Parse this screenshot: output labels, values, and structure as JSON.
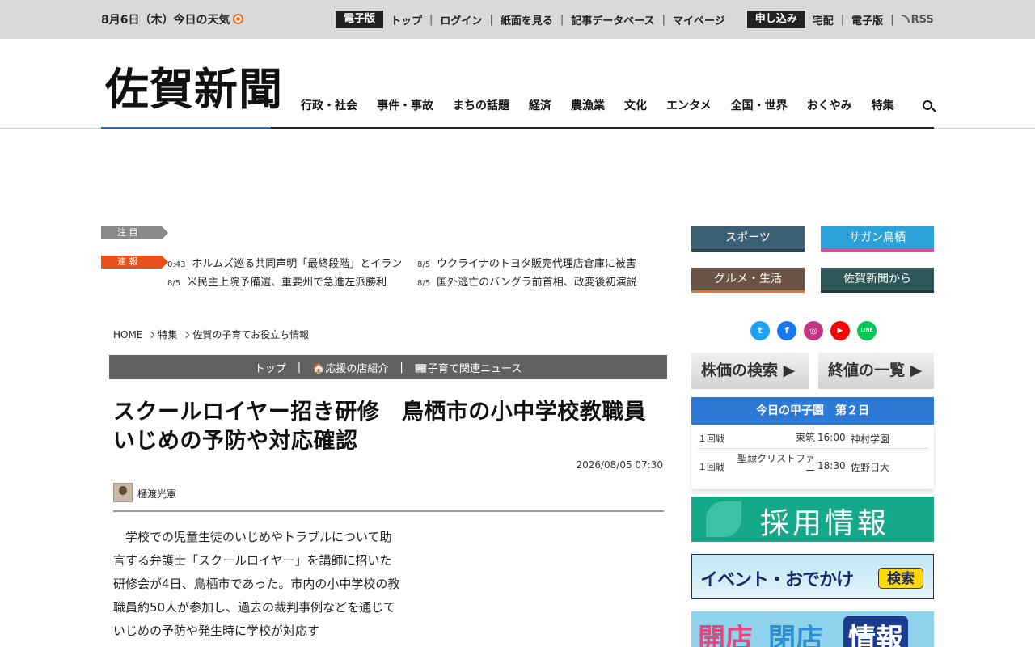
{
  "topbar": {
    "date": "8月6日（木）",
    "weather_label": "今日の天気",
    "nav": [
      "電子版",
      "トップ",
      "ログイン",
      "紙面を見る",
      "記事データベース",
      "マイページ"
    ],
    "nav2": [
      "申し込み",
      "宅配",
      "電子版",
      "RSS"
    ],
    "separator": "|"
  },
  "header": {
    "logo": "佐賀新聞",
    "nav": [
      "行政・社会",
      "事件・事故",
      "まちの話題",
      "経済",
      "農漁業",
      "文化",
      "エンタメ",
      "全国・世界",
      "おくやみ",
      "特集"
    ]
  },
  "ticker": {
    "attention_label": "注 目",
    "breaking_label": "速 報",
    "items": [
      {
        "time": "0:43",
        "text": "ホルムズ巡る共同声明「最終段階」とイラン"
      },
      {
        "time": "8/5",
        "text": "ウクライナのトヨタ販売代理店倉庫に被害"
      },
      {
        "time": "8/5",
        "text": "米民主上院予備選、重要州で急進左派勝利"
      },
      {
        "time": "8/5",
        "text": "国外逃亡のバングラ前首相、政変後初演説"
      }
    ]
  },
  "breadcrumb": [
    "HOME",
    "特集",
    "佐賀の子育てお役立ち情報"
  ],
  "subnav": {
    "items": [
      "トップ",
      "🏠応援の店紹介",
      "📰子育て関連ニュース"
    ],
    "separator": "|"
  },
  "article": {
    "headline_line1": "スクールロイヤー招き研修　鳥栖市の小中学校教職員",
    "headline_line2": "いじめの予防や対応確認",
    "date": "2026/08/05 07:30",
    "author": "樋渡光憲",
    "body": "　学校での児童生徒のいじめやトラブルについて助言する弁護士「スクールロイヤー」を講師に招いた研修会が4日、鳥栖市であった。市内の小中学校の教職員約50人が参加し、過去の裁判事例などを通じていじめの予防や発生時に学校が対応す"
  },
  "sidebar": {
    "categories": [
      {
        "label": "スポーツ",
        "bg": "#3b5f73",
        "bar": "#2a4556"
      },
      {
        "label": "サガン鳥栖",
        "bg": "#2aa1d9",
        "bar": "#e4478e"
      },
      {
        "label": "グルメ・生活",
        "bg": "#6b5446",
        "bar": "#e8762d"
      },
      {
        "label": "佐賀新聞から",
        "bg": "#2f5658",
        "bar": "#1f3b3d"
      }
    ],
    "social": [
      {
        "name": "twitter",
        "glyph": "t",
        "color": "#1da1f2"
      },
      {
        "name": "facebook",
        "glyph": "f",
        "color": "#1877f2"
      },
      {
        "name": "instagram",
        "glyph": "◎",
        "color": "#c13584"
      },
      {
        "name": "youtube",
        "glyph": "▶",
        "color": "#ff0000"
      },
      {
        "name": "line",
        "glyph": "LINE",
        "color": "#06c755"
      }
    ],
    "stock_search": "株価の検索 ▶",
    "stock_list": "終値の一覧 ▶",
    "koshien": {
      "title": "今日の甲子園　第２日",
      "games": [
        {
          "round": "１回戦",
          "team1": "東筑",
          "time": "16:00",
          "team2": "神村学園"
        },
        {
          "round": "１回戦",
          "team1": "聖隷クリストファー",
          "time": "18:30",
          "team2": "佐野日大"
        }
      ]
    },
    "banner_recruit": "採用情報",
    "banner_event": "イベント・おでかけ",
    "banner_event_btn": "検索",
    "banner_shop": [
      "開店",
      "閉店",
      "情報"
    ]
  }
}
